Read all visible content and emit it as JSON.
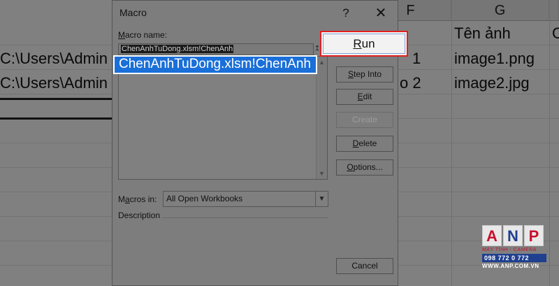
{
  "sheet": {
    "columns": [
      "F",
      "G"
    ],
    "row1": {
      "g": "Tên ảnh",
      "h": "C"
    },
    "row2": {
      "path": "C:\\Users\\Admin",
      "f": "1",
      "g": "image1.png"
    },
    "row3": {
      "path": "C:\\Users\\Admin",
      "f": "o 2",
      "g": "image2.jpg"
    }
  },
  "dialog": {
    "title": "Macro",
    "help": "?",
    "close": "✕",
    "macro_name_label": "Macro name:",
    "macro_name_value": "ChenAnhTuDong.xlsm!ChenAnh",
    "pick_icon": "↥",
    "list_items": [
      "ChenAnhTuDong.xlsm!ChenAnh"
    ],
    "buttons": {
      "run": "Run",
      "step_into": "Step Into",
      "edit": "Edit",
      "create": "Create",
      "delete": "Delete",
      "options": "Options...",
      "cancel": "Cancel"
    },
    "macros_in_label": "Macros in:",
    "macros_in_value": "All Open Workbooks",
    "description_label": "Description"
  },
  "watermark": {
    "letters": [
      "A",
      "N",
      "P"
    ],
    "tagline": "MÁY TÍNH - CAMERA",
    "phone": "098 772 0 772",
    "site": "WWW.ANP.COM.VN"
  },
  "colors": {
    "accent_selection": "#1a6fd8",
    "run_highlight": "#e02020",
    "logo_red": "#c8102e",
    "logo_blue": "#1f3f8f"
  }
}
